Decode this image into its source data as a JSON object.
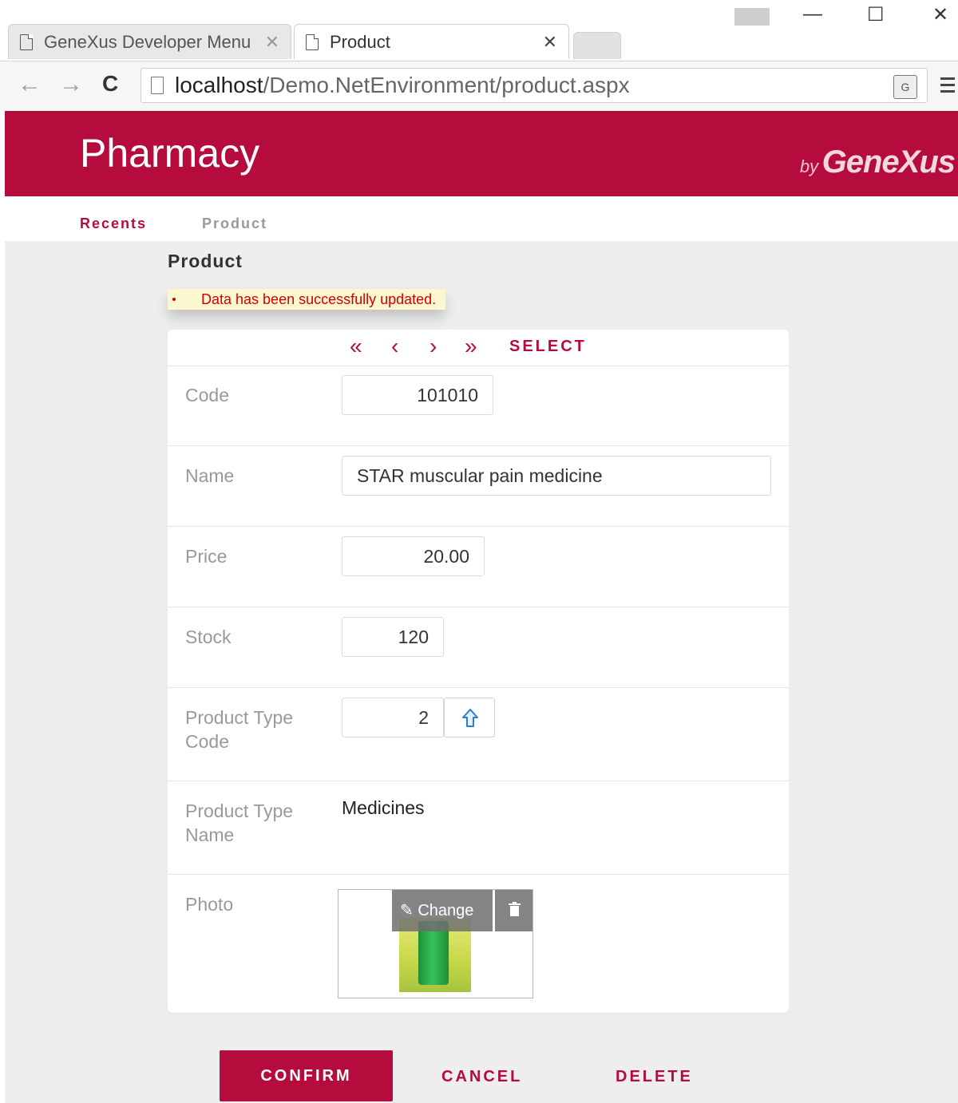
{
  "browser": {
    "tabs": [
      {
        "title": "GeneXus Developer Menu",
        "close": "✕"
      },
      {
        "title": "Product",
        "close": "✕"
      }
    ],
    "window_controls": {
      "minimize": "—",
      "maximize": "☐",
      "close": "✕"
    },
    "nav": {
      "back": "←",
      "forward": "→",
      "reload": "C"
    },
    "url": {
      "host": "localhost",
      "path": "/Demo.NetEnvironment/product.aspx"
    }
  },
  "app": {
    "title": "Pharmacy",
    "brand_by": "by",
    "brand_name": "GeneXus"
  },
  "breadcrumb": {
    "recents": "Recents",
    "current": "Product"
  },
  "page": {
    "title": "Product",
    "message": "Data has been successfully updated."
  },
  "record_nav": {
    "first": "«",
    "prev": "‹",
    "next": "›",
    "last": "»",
    "select": "SELECT"
  },
  "form": {
    "code": {
      "label": "Code",
      "value": "101010"
    },
    "name": {
      "label": "Name",
      "value": "STAR muscular pain medicine"
    },
    "price": {
      "label": "Price",
      "value": "20.00"
    },
    "stock": {
      "label": "Stock",
      "value": "120"
    },
    "product_type_code": {
      "label_1": "Product Type",
      "label_2": "Code",
      "value": "2"
    },
    "product_type_name": {
      "label_1": "Product Type",
      "label_2": "Name",
      "value": "Medicines"
    },
    "photo": {
      "label": "Photo",
      "change_label": "Change"
    }
  },
  "actions": {
    "confirm": "CONFIRM",
    "cancel": "CANCEL",
    "delete": "DELETE"
  },
  "colors": {
    "brand": "#b50b3d",
    "background": "#eeeeee",
    "message_bg": "#fbf7cf",
    "message_text": "#d20000"
  }
}
